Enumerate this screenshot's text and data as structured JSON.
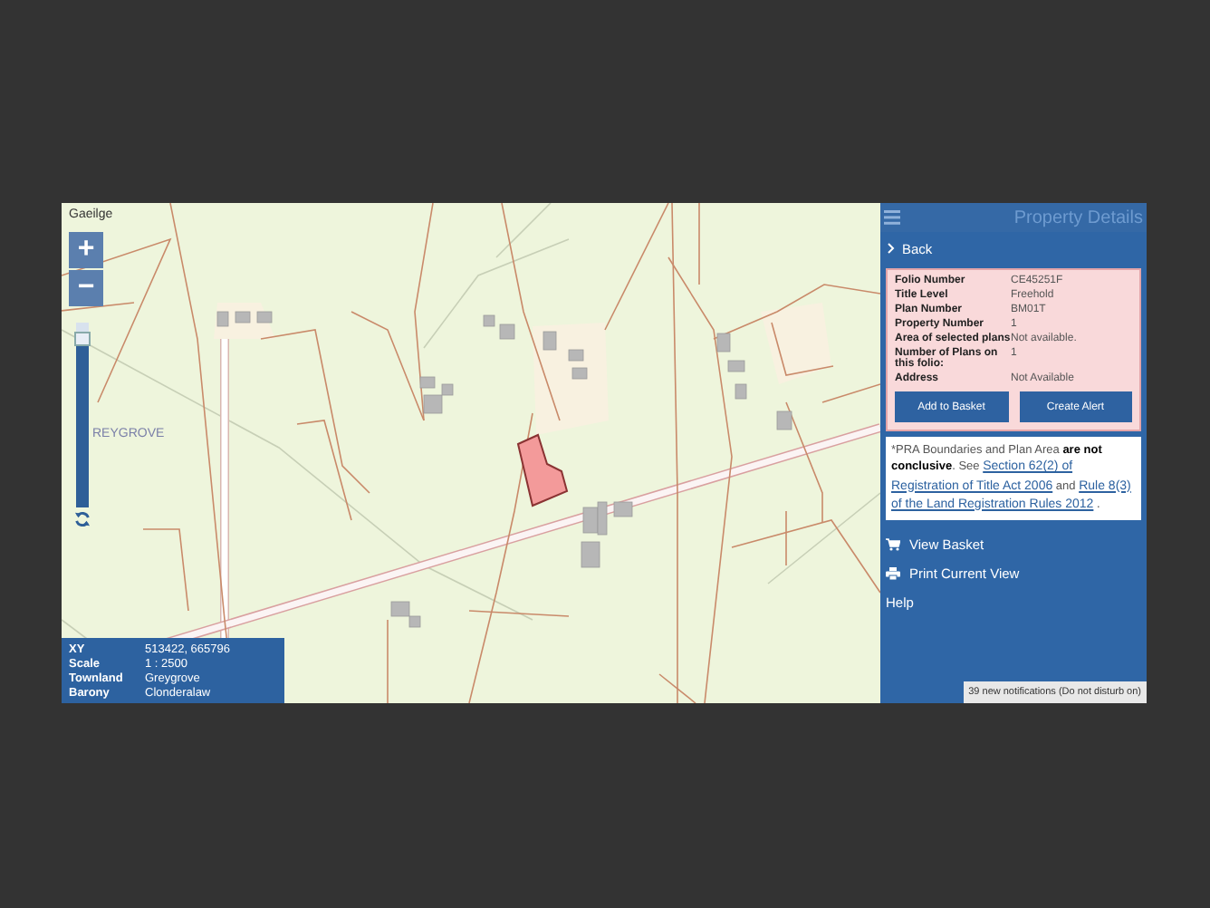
{
  "map": {
    "language_link": "Gaeilge",
    "place_label": "REYGROVE",
    "zoom_in": "+",
    "zoom_out": "−",
    "zoom": {
      "level": 0.95
    },
    "info": [
      {
        "label": "XY",
        "value": "513422, 665796"
      },
      {
        "label": "Scale",
        "value": "1 : 2500"
      },
      {
        "label": "Townland",
        "value": "Greygrove"
      },
      {
        "label": "Barony",
        "value": "Clonderalaw"
      }
    ]
  },
  "panel": {
    "title": "Property Details",
    "back": "Back",
    "details": [
      {
        "label": "Folio Number",
        "value": "CE45251F"
      },
      {
        "label": "Title Level",
        "value": "Freehold"
      },
      {
        "label": "Plan Number",
        "value": "BM01T"
      },
      {
        "label": "Property Number",
        "value": "1"
      },
      {
        "label": "Area of selected plans",
        "value": "Not available."
      },
      {
        "label": "Number of Plans on this folio:",
        "value": "1"
      },
      {
        "label": "Address",
        "value": "Not Available"
      }
    ],
    "buttons": [
      "Add to Basket",
      "Create Alert"
    ],
    "note": [
      {
        "kind": "text",
        "text": "*PRA Boundaries and Plan Area **are not conclusive**. See"
      },
      {
        "kind": "link",
        "text": "Section 62(2) of"
      },
      {
        "kind": "link",
        "text": "Registration of Title Act 2006"
      },
      {
        "kind": "text",
        "text": "and"
      },
      {
        "kind": "link",
        "text": "Rule 8(3)"
      },
      {
        "kind": "link",
        "text": "of the Land Registration Rules 2012"
      },
      {
        "kind": "text",
        "text": "."
      }
    ],
    "menu": [
      {
        "kind": "basket",
        "label": "View Basket"
      },
      {
        "kind": "print",
        "label": "Print Current View"
      },
      {
        "kind": "plain",
        "label": "Help"
      }
    ],
    "notification": "39 new notifications (Do not disturb on)"
  }
}
